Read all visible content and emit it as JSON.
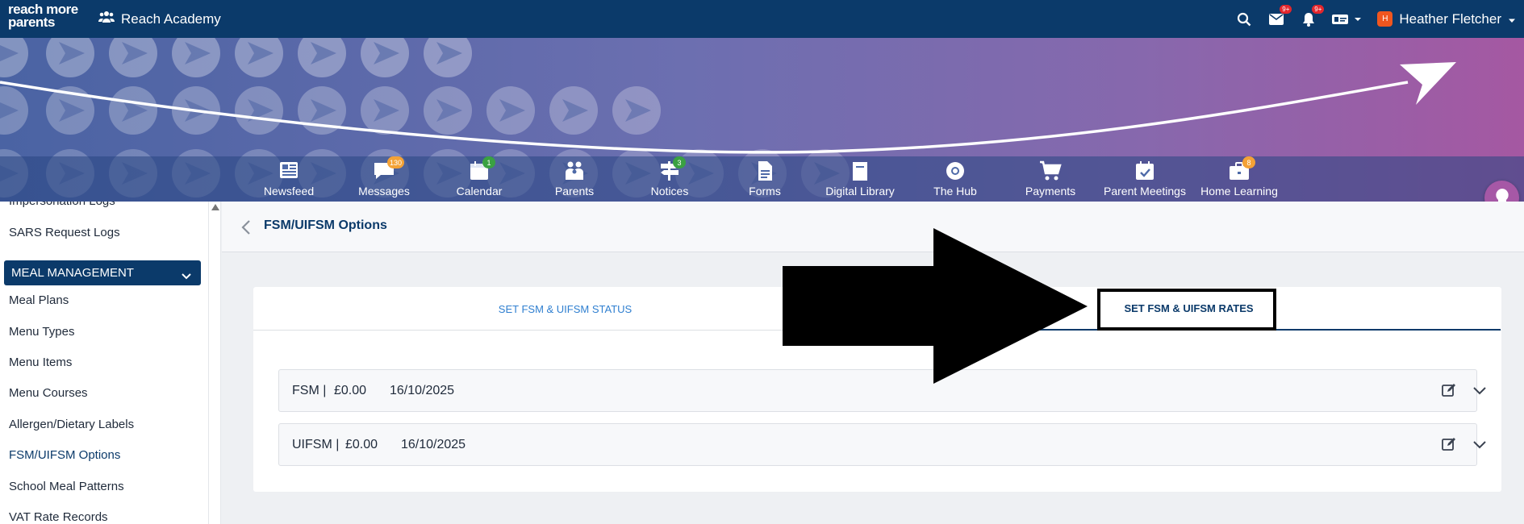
{
  "app": {
    "logo_line1": "reach more",
    "logo_line2": "parents",
    "org_name": "Reach Academy",
    "user_initial": "H",
    "user_name": "Heather Fletcher",
    "mail_badge": "9+",
    "bell_badge": "9+"
  },
  "nav": [
    {
      "label": "Newsfeed",
      "badge": "",
      "icon": "newspaper-icon"
    },
    {
      "label": "Messages",
      "badge": "130",
      "icon": "chat-icon"
    },
    {
      "label": "Calendar",
      "badge": "1",
      "icon": "calendar-icon"
    },
    {
      "label": "Parents",
      "badge": "",
      "icon": "people-icon"
    },
    {
      "label": "Notices",
      "badge": "3",
      "icon": "signpost-icon"
    },
    {
      "label": "Forms",
      "badge": "",
      "icon": "document-icon"
    },
    {
      "label": "Digital Library",
      "badge": "",
      "icon": "book-icon"
    },
    {
      "label": "The Hub",
      "badge": "",
      "icon": "lifebuoy-icon"
    },
    {
      "label": "Payments",
      "badge": "",
      "icon": "cart-icon"
    },
    {
      "label": "Parent Meetings",
      "badge": "",
      "icon": "calendar-check-icon"
    },
    {
      "label": "Home Learning",
      "badge": "8",
      "icon": "briefcase-icon"
    }
  ],
  "sidebar": {
    "items_top": [
      "Impersonation Logs",
      "SARS Request Logs"
    ],
    "section": "MEAL MANAGEMENT",
    "items": [
      "Meal Plans",
      "Menu Types",
      "Menu Items",
      "Menu Courses",
      "Allergen/Dietary Labels",
      "FSM/UIFSM Options",
      "School Meal Patterns",
      "VAT Rate Records"
    ],
    "active": "FSM/UIFSM Options"
  },
  "page": {
    "title": "FSM/UIFSM Options",
    "tabs": [
      "SET FSM & UIFSM STATUS",
      "SET FSM & UIFSM RATES"
    ],
    "active_tab": "SET FSM & UIFSM RATES",
    "rates": [
      {
        "label": "FSM |",
        "amount": "£0.00",
        "date": "16/10/2025"
      },
      {
        "label": "UIFSM |",
        "amount": "£0.00",
        "date": "16/10/2025"
      }
    ]
  },
  "colors": {
    "navy": "#0b3a6a",
    "link_blue": "#2f7fd0",
    "badge_red": "#e4262c",
    "badge_orange": "#f4a236",
    "badge_green": "#3aa142",
    "accent_purple": "#a658a6"
  }
}
